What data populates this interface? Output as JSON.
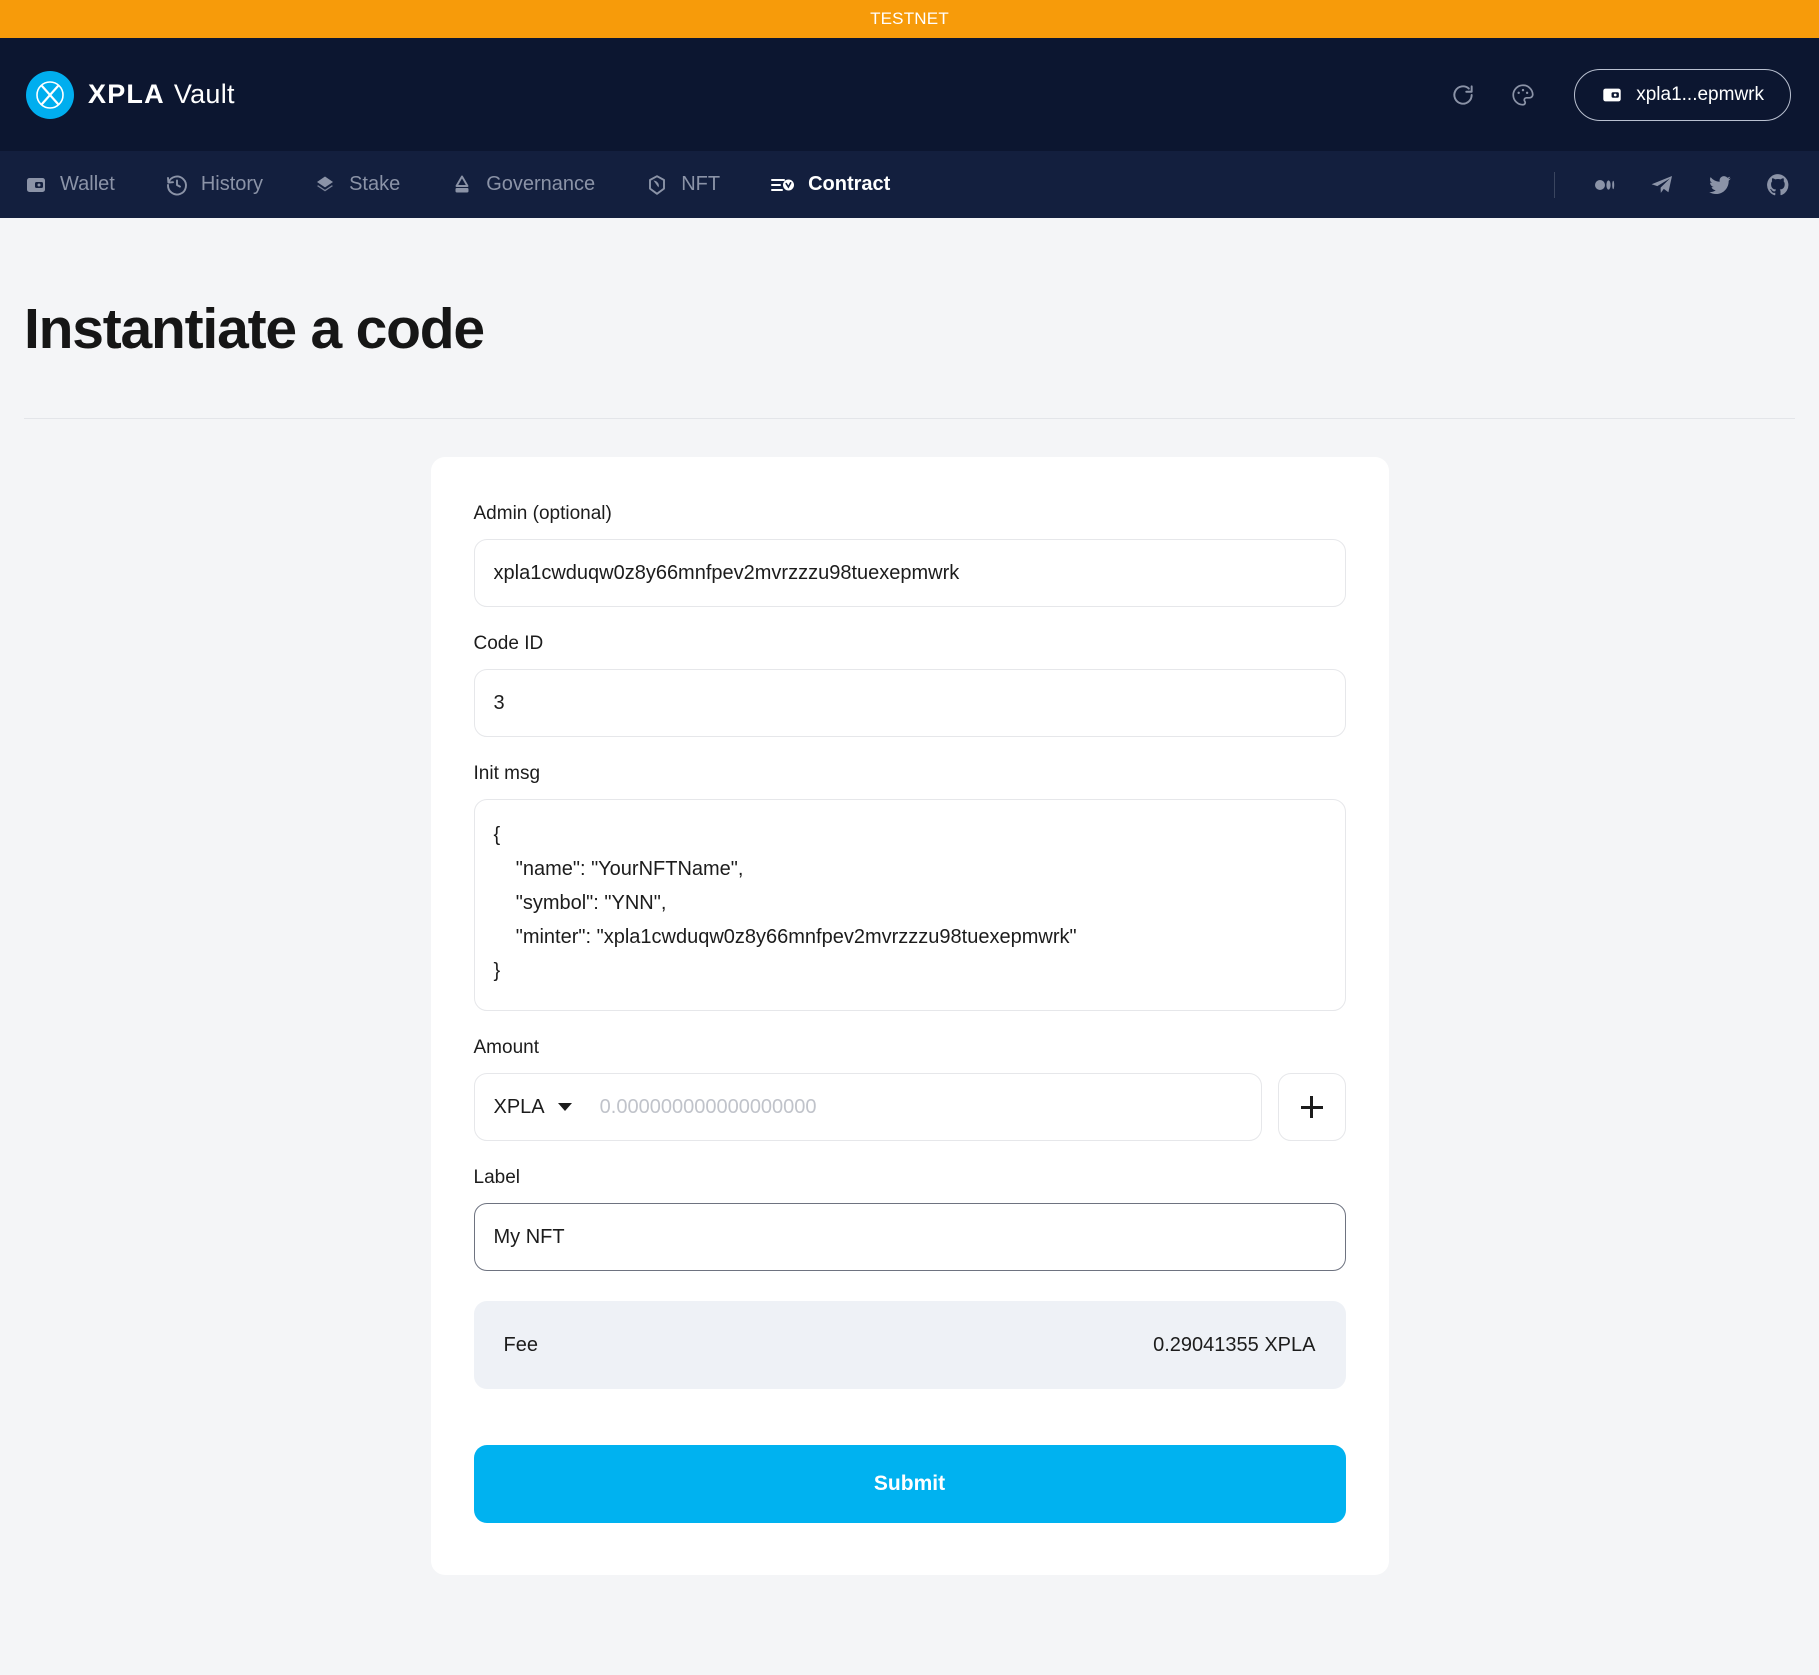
{
  "banner": {
    "label": "TESTNET",
    "color": "#f79b0a"
  },
  "header": {
    "brand_primary": "XPLA",
    "brand_secondary": "Vault",
    "logo_icon": "xpla-x-logo-icon",
    "refresh_icon": "refresh-icon",
    "theme_icon": "palette-icon",
    "wallet_icon": "wallet-icon",
    "wallet_address": "xpla1...epmwrk",
    "accent": "#00aeef",
    "background": "#0c1630"
  },
  "nav": {
    "background": "#131f3e",
    "items": [
      {
        "label": "Wallet",
        "icon": "wallet-icon",
        "active": false
      },
      {
        "label": "History",
        "icon": "history-clock-icon",
        "active": false
      },
      {
        "label": "Stake",
        "icon": "layers-diamond-icon",
        "active": false
      },
      {
        "label": "Governance",
        "icon": "gavel-stamp-icon",
        "active": false
      },
      {
        "label": "NFT",
        "icon": "nft-hexagon-icon",
        "active": false
      },
      {
        "label": "Contract",
        "icon": "contract-list-icon",
        "active": true
      }
    ],
    "social": [
      {
        "icon": "medium-icon"
      },
      {
        "icon": "telegram-icon"
      },
      {
        "icon": "twitter-icon"
      },
      {
        "icon": "github-icon"
      }
    ]
  },
  "page": {
    "title": "Instantiate a code"
  },
  "form": {
    "admin": {
      "label": "Admin (optional)",
      "value": "xpla1cwduqw0z8y66mnfpev2mvrzzzu98tuexepmwrk",
      "placeholder": ""
    },
    "code_id": {
      "label": "Code ID",
      "value": "3",
      "placeholder": ""
    },
    "init_msg": {
      "label": "Init msg",
      "value": "{\n    \"name\": \"YourNFTName\",\n    \"symbol\": \"YNN\",\n    \"minter\": \"xpla1cwduqw0z8y66mnfpev2mvrzzzu98tuexepmwrk\"\n}"
    },
    "amount": {
      "label": "Amount",
      "denom": "XPLA",
      "value": "",
      "placeholder": "0.000000000000000000",
      "add_button_icon": "plus-icon"
    },
    "label_field": {
      "label": "Label",
      "value": "My NFT",
      "placeholder": "",
      "focused": true
    },
    "fee": {
      "label": "Fee",
      "value": "0.29041355 XPLA"
    },
    "submit": {
      "label": "Submit",
      "color": "#00b2f0"
    }
  }
}
